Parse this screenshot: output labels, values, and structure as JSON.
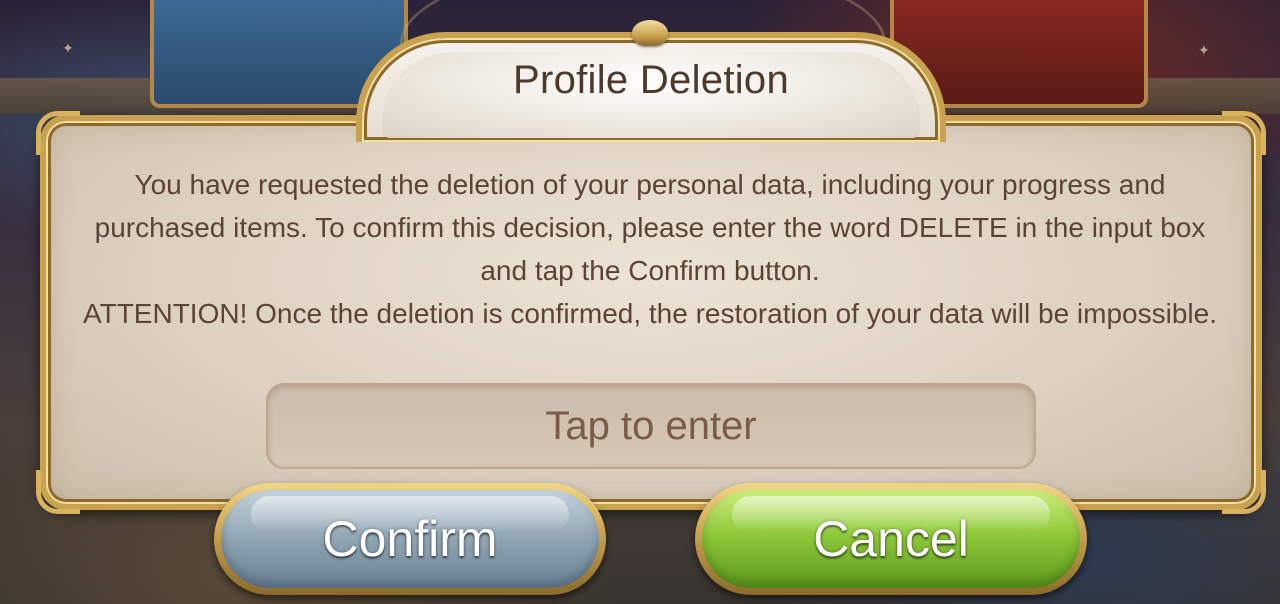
{
  "dialog": {
    "title": "Profile Deletion",
    "body": {
      "line1": "You have requested the deletion of your personal data, including your progress and purchased items. To confirm this decision, please enter the word DELETE in the input box and tap the Confirm button.",
      "line2": "ATTENTION! Once the deletion is confirmed, the restoration of your data will be impossible."
    },
    "input": {
      "placeholder": "Tap to enter",
      "value": ""
    },
    "buttons": {
      "confirm_label": "Confirm",
      "cancel_label": "Cancel"
    }
  },
  "colors": {
    "title_text": "#4d3a2c",
    "body_text": "#5b4434",
    "panel_bg": "#ddd1c1",
    "gold_border": "#c9a24f",
    "confirm_button": "#94a9b7",
    "cancel_button": "#8fc93a"
  },
  "icons": {
    "sparkle": "sparkle-icon"
  }
}
